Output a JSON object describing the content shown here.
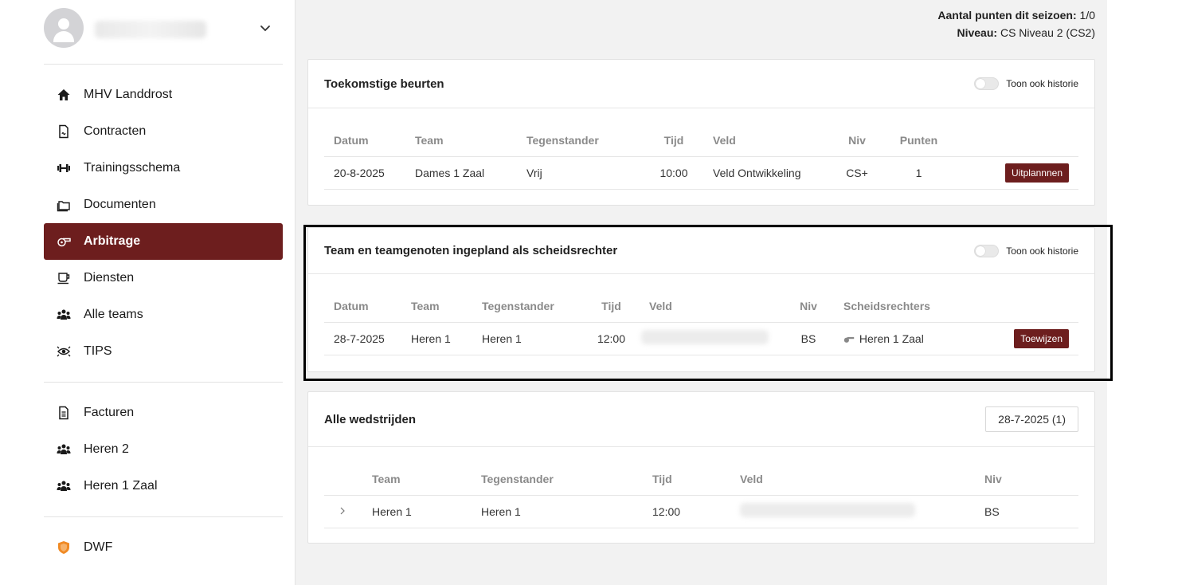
{
  "sidebar": {
    "nav": [
      {
        "label": "MHV Landdrost",
        "icon": "home-icon"
      },
      {
        "label": "Contracten",
        "icon": "contract-icon"
      },
      {
        "label": "Trainingsschema",
        "icon": "dumbbell-icon"
      },
      {
        "label": "Documenten",
        "icon": "folder-icon"
      },
      {
        "label": "Arbitrage",
        "icon": "whistle-icon",
        "active": true
      },
      {
        "label": "Diensten",
        "icon": "coffee-icon"
      },
      {
        "label": "Alle teams",
        "icon": "users-icon"
      },
      {
        "label": "TIPS",
        "icon": "eye-icon"
      }
    ],
    "nav2": [
      {
        "label": "Facturen",
        "icon": "invoice-icon"
      },
      {
        "label": "Heren 2",
        "icon": "users-icon"
      },
      {
        "label": "Heren 1 Zaal",
        "icon": "users-icon"
      }
    ],
    "nav3": [
      {
        "label": "DWF",
        "icon": "dwf-shield-icon"
      }
    ]
  },
  "info": {
    "points_label": "Aantal punten dit seizoen:",
    "points_value": "1/0",
    "level_label": "Niveau:",
    "level_value": "CS Niveau 2 (CS2)"
  },
  "upcoming": {
    "title": "Toekomstige beurten",
    "toggle_label": "Toon ook historie",
    "headers": [
      "Datum",
      "Team",
      "Tegenstander",
      "Tijd",
      "Veld",
      "Niv",
      "Punten"
    ],
    "rows": [
      {
        "datum": "20-8-2025",
        "team": "Dames 1 Zaal",
        "tegenstander": "Vrij",
        "tijd": "10:00",
        "veld": "Veld Ontwikkeling",
        "niv": "CS+",
        "punten": "1",
        "button": "Uitplannnen"
      }
    ]
  },
  "team_refs": {
    "title": "Team en teamgenoten ingepland als scheidsrechter",
    "toggle_label": "Toon ook historie",
    "headers": [
      "Datum",
      "Team",
      "Tegenstander",
      "Tijd",
      "Veld",
      "Niv",
      "Scheidsrechters"
    ],
    "rows": [
      {
        "datum": "28-7-2025",
        "team": "Heren 1",
        "tegenstander": "Heren 1",
        "tijd": "12:00",
        "niv": "BS",
        "scheidsrechters": "Heren 1 Zaal",
        "button": "Toewijzen"
      }
    ]
  },
  "all_matches": {
    "title": "Alle wedstrijden",
    "date_selector": "28-7-2025 (1)",
    "headers": [
      "Team",
      "Tegenstander",
      "Tijd",
      "Veld",
      "Niv"
    ],
    "rows": [
      {
        "team": "Heren 1",
        "tegenstander": "Heren 1",
        "tijd": "12:00",
        "niv": "BS"
      }
    ]
  },
  "colors": {
    "accent": "#6d1e1e",
    "background": "#f2f2f2"
  }
}
